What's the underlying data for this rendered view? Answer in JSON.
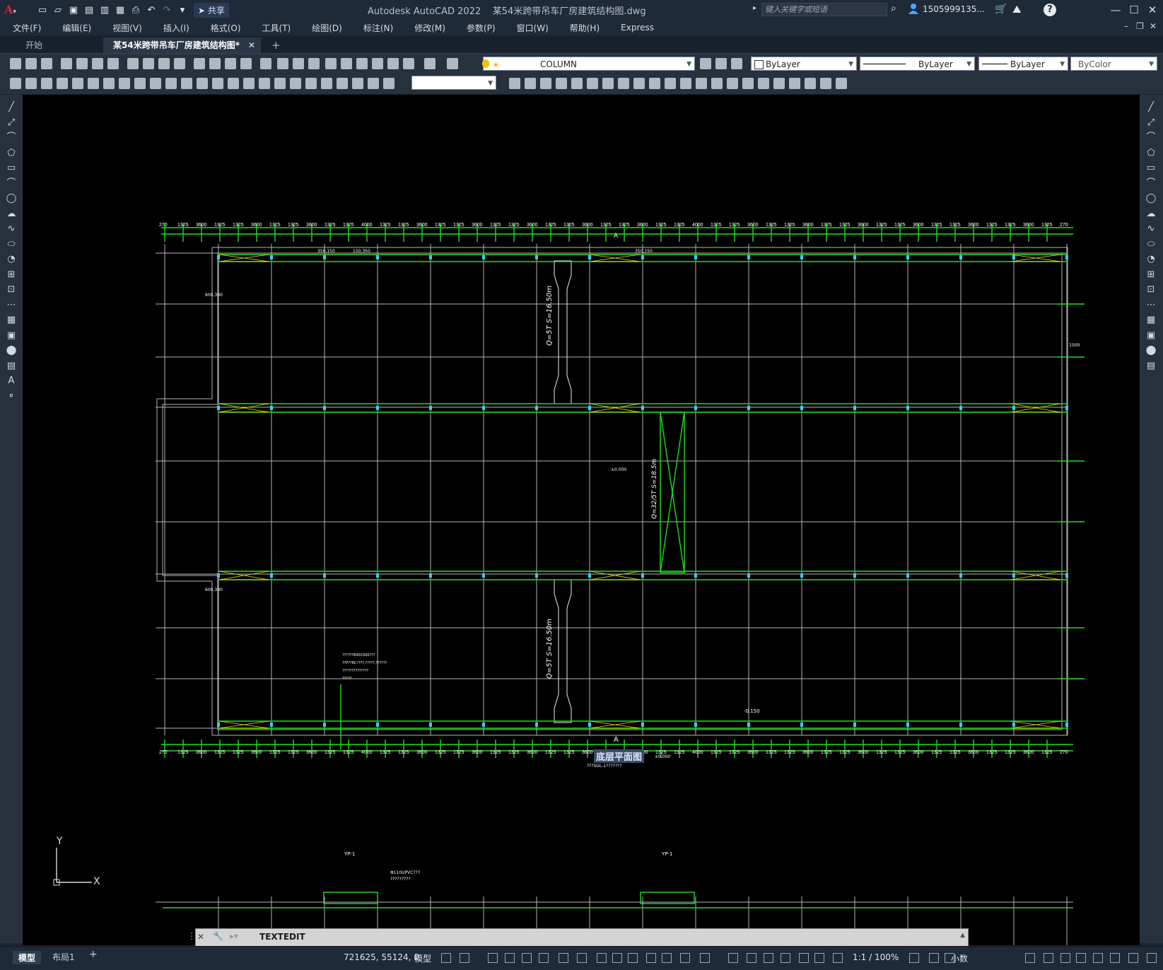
{
  "app": {
    "title": "Autodesk AutoCAD 2022",
    "document": "某54米跨带吊车厂房建筑结构图.dwg",
    "share_label": "共享",
    "search_placeholder": "键入关键字或短语",
    "user": "1505999135...",
    "colors": {
      "accent": "#00ff00",
      "bg": "#000000",
      "chrome": "#1f2a38"
    }
  },
  "menu": [
    "文件(F)",
    "编辑(E)",
    "视图(V)",
    "插入(I)",
    "格式(O)",
    "工具(T)",
    "绘图(D)",
    "标注(N)",
    "修改(M)",
    "参数(P)",
    "窗口(W)",
    "帮助(H)",
    "Express"
  ],
  "tabs": [
    {
      "label": "开始"
    },
    {
      "label": "某54米跨带吊车厂房建筑结构图*"
    }
  ],
  "props": {
    "layer": "COLUMN",
    "color": "ByLayer",
    "linetype": "ByLayer",
    "lineweight": "ByLayer",
    "plotstyle": "ByColor"
  },
  "drawing": {
    "dim_top": [
      "270",
      "1325",
      "3600",
      "1325",
      "1325",
      "3600",
      "1325",
      "1325",
      "3600",
      "1325",
      "1325",
      "4000",
      "1325",
      "1325",
      "3600",
      "1325",
      "1325",
      "3600",
      "1325",
      "1325",
      "3600",
      "1325",
      "1325",
      "3600",
      "1325",
      "1325",
      "3600",
      "1325",
      "1325",
      "4000",
      "1325",
      "1325",
      "3600",
      "1325",
      "1325",
      "3600",
      "1325",
      "1325",
      "3600",
      "1325",
      "1325",
      "3600",
      "1325",
      "1325",
      "3600",
      "1325",
      "1325",
      "3600",
      "1325",
      "270"
    ],
    "crane_top": "Q=5T  S=16.50m",
    "crane_mid": "Q=32/5T  S=18.5m",
    "crane_bot": "Q=5T  S=16.50m",
    "section_mark": "A",
    "elev_mid": "±0.000",
    "elev_title": "±0.000",
    "elev_bottom": "-0.150",
    "plan_title": "底层平面图",
    "plan_subtitle": "???SGL-1???????",
    "labels": {
      "l600_300_a": "600,300",
      "l600_300_b": "600,300",
      "l350_150": "350,150",
      "l150_350": "150,350",
      "l1500": "1500",
      "l350_150b": "350,150"
    },
    "notes": [
      "??????600X300???",
      "??P??RC????,?????,??????",
      "??????????????",
      "?????"
    ],
    "yp": [
      "YP-1",
      "YP-1"
    ],
    "pipe_note": "Φ110UPVC???",
    "pipe_note2": "?????????"
  },
  "ucs": {
    "y": "Y",
    "x": "X"
  },
  "command": {
    "text": "TEXTEDIT"
  },
  "status": {
    "model_tab": "模型",
    "layout_tab": "布局1",
    "coords": "721625, 55124, 0",
    "model_label": "模型",
    "scale": "1:1 / 100%",
    "units": "小数"
  }
}
